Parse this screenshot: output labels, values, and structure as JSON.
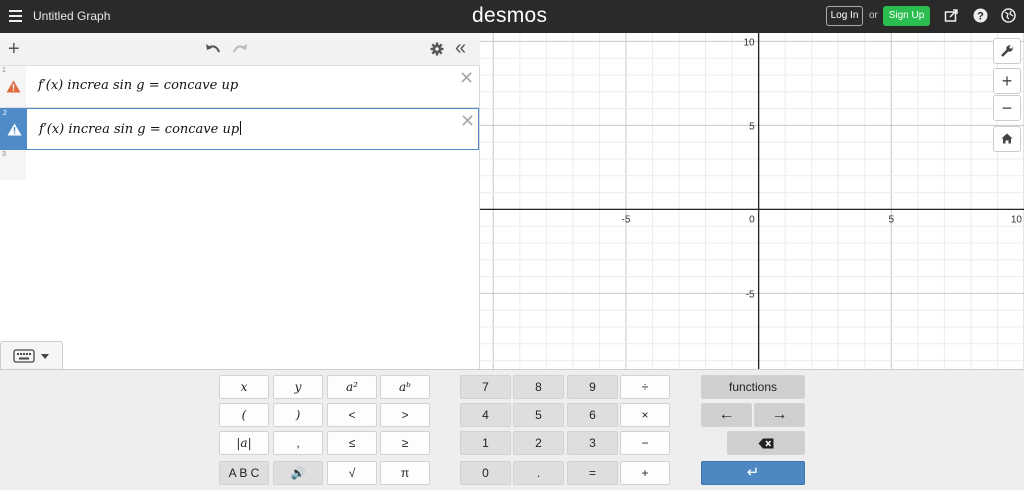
{
  "topbar": {
    "graph_title": "Untitled Graph",
    "brand": "desmos",
    "login_label": "Log In",
    "or_label": "or",
    "signup_label": "Sign Up",
    "bg_color": "#2a2a2a",
    "signup_color": "#2bbd50"
  },
  "expressions": [
    {
      "num": "1",
      "latex": "f′(x) increa sin g = concave up",
      "error": true,
      "active": false
    },
    {
      "num": "2",
      "latex": "f′(x) increa sin g = concave up",
      "error": true,
      "active": true
    },
    {
      "num": "3",
      "latex": "",
      "error": false,
      "active": false
    }
  ],
  "graph": {
    "x_ticks": [
      "-5",
      "0",
      "5",
      "10"
    ],
    "y_ticks": [
      "10",
      "5",
      "-5"
    ],
    "xlim": [
      -10.5,
      10
    ],
    "ylim": [
      -9.5,
      10.5
    ],
    "grid": true
  },
  "keypad": {
    "left": [
      [
        "x",
        "y",
        "a²",
        "aᵇ"
      ],
      [
        "(",
        ")",
        "<",
        ">"
      ],
      [
        "|a|",
        ",",
        "≤",
        "≥"
      ],
      [
        "A B C",
        "🔊",
        "√",
        "π"
      ]
    ],
    "mid": [
      [
        "7",
        "8",
        "9",
        "÷"
      ],
      [
        "4",
        "5",
        "6",
        "×"
      ],
      [
        "1",
        "2",
        "3",
        "−"
      ],
      [
        "0",
        ".",
        "=",
        "+"
      ]
    ],
    "functions_label": "functions",
    "left_arrow": "←",
    "right_arrow": "→",
    "backspace": "⌫",
    "enter": "↵",
    "enter_color": "#4f87c2"
  }
}
